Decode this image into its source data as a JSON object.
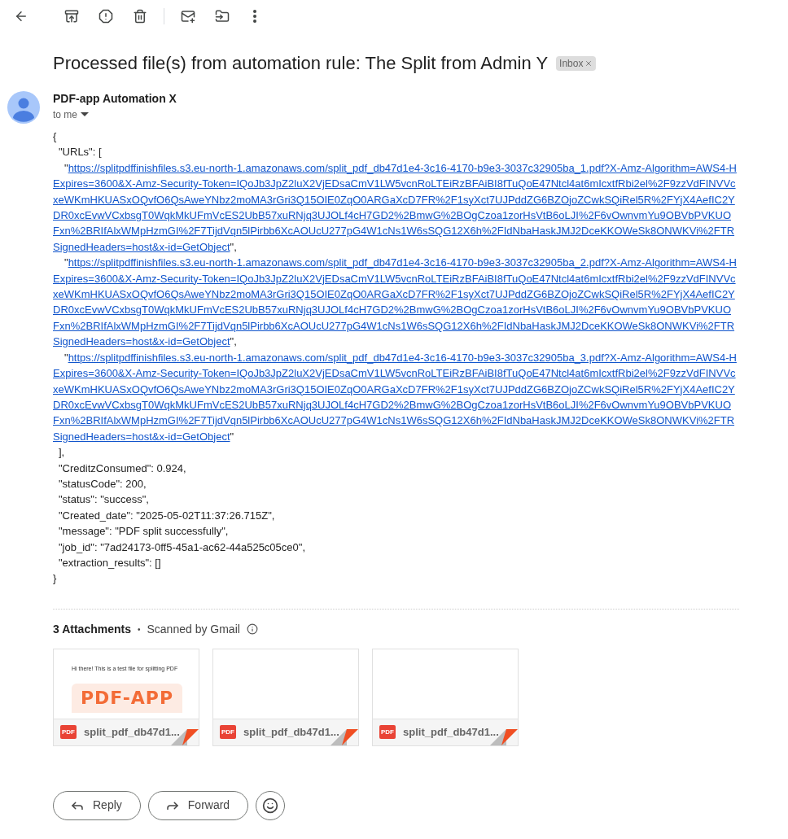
{
  "subject": "Processed file(s) from automation rule: The Split from Admin Y",
  "label": {
    "text": "Inbox",
    "removable": true
  },
  "sender": {
    "name": "PDF-app Automation X",
    "recipient": "to me"
  },
  "body_before": [
    {
      "kind": "brace",
      "text": "{"
    },
    {
      "kind": "member",
      "text": "\"URLs\": ["
    }
  ],
  "urls": [
    {
      "open": "\"",
      "close": "\",",
      "lines": [
        "https://splitpdffinishfiles.s3.eu-north-1.amazonaws.com/split_pdf_db47d1e4-3c16-4170-b9e3-3037c32905ba_1.pdf?X-Amz-Algorithm=AWS4-H",
        "Expires=3600&X-Amz-Security-Token=IQoJb3JpZ2luX2VjEDsaCmV1LW5vcnRoLTEiRzBFAiBI8fTuQoE47Ntcl4at6mIcxtfRbi2el%2F9zzVdFINVVc",
        "xeWKmHKUASxOQvfO6QsAweYNbz2moMA3rGri3Q15OIE0ZqO0ARGaXcD7FR%2F1syXct7UJPddZG6BZOjoZCwkSQiRel5R%2FYjX4AefIC2Y",
        "DR0xcEvwVCxbsgT0WqkMkUFmVcES2UbB57xuRNjq3UJOLf4cH7GD2%2BmwG%2BOgCzoa1zorHsVtB6oLJI%2F6vOwnvmYu9OBVbPVKUO",
        "Fxn%2BRIfAlxWMpHzmGI%2F7TijdVqn5lPirbb6XcAOUcU277pG4W1cNs1W6sSQG12X6h%2FIdNbaHaskJMJ2DceKKOWeSk8ONWKVi%2FTR",
        "SignedHeaders=host&x-id=GetObject"
      ]
    },
    {
      "open": "\"",
      "close": "\",",
      "lines": [
        "https://splitpdffinishfiles.s3.eu-north-1.amazonaws.com/split_pdf_db47d1e4-3c16-4170-b9e3-3037c32905ba_2.pdf?X-Amz-Algorithm=AWS4-H",
        "Expires=3600&X-Amz-Security-Token=IQoJb3JpZ2luX2VjEDsaCmV1LW5vcnRoLTEiRzBFAiBI8fTuQoE47Ntcl4at6mIcxtfRbi2el%2F9zzVdFINVVc",
        "xeWKmHKUASxOQvfO6QsAweYNbz2moMA3rGri3Q15OIE0ZqO0ARGaXcD7FR%2F1syXct7UJPddZG6BZOjoZCwkSQiRel5R%2FYjX4AefIC2Y",
        "DR0xcEvwVCxbsgT0WqkMkUFmVcES2UbB57xuRNjq3UJOLf4cH7GD2%2BmwG%2BOgCzoa1zorHsVtB6oLJI%2F6vOwnvmYu9OBVbPVKUO",
        "Fxn%2BRIfAlxWMpHzmGI%2F7TijdVqn5lPirbb6XcAOUcU277pG4W1cNs1W6sSQG12X6h%2FIdNbaHaskJMJ2DceKKOWeSk8ONWKVi%2FTR",
        "SignedHeaders=host&x-id=GetObject"
      ]
    },
    {
      "open": "\"",
      "close": "\"",
      "lines": [
        "https://splitpdffinishfiles.s3.eu-north-1.amazonaws.com/split_pdf_db47d1e4-3c16-4170-b9e3-3037c32905ba_3.pdf?X-Amz-Algorithm=AWS4-H",
        "Expires=3600&X-Amz-Security-Token=IQoJb3JpZ2luX2VjEDsaCmV1LW5vcnRoLTEiRzBFAiBI8fTuQoE47Ntcl4at6mIcxtfRbi2el%2F9zzVdFINVVc",
        "xeWKmHKUASxOQvfO6QsAweYNbz2moMA3rGri3Q15OIE0ZqO0ARGaXcD7FR%2F1syXct7UJPddZG6BZOjoZCwkSQiRel5R%2FYjX4AefIC2Y",
        "DR0xcEvwVCxbsgT0WqkMkUFmVcES2UbB57xuRNjq3UJOLf4cH7GD2%2BmwG%2BOgCzoa1zorHsVtB6oLJI%2F6vOwnvmYu9OBVbPVKUO",
        "Fxn%2BRIfAlxWMpHzmGI%2F7TijdVqn5lPirbb6XcAOUcU277pG4W1cNs1W6sSQG12X6h%2FIdNbaHaskJMJ2DceKKOWeSk8ONWKVi%2FTR",
        "SignedHeaders=host&x-id=GetObject"
      ]
    }
  ],
  "body_after": [
    {
      "kind": "member",
      "text": "],"
    },
    {
      "kind": "member",
      "text": "\"CreditzConsumed\": 0.924,"
    },
    {
      "kind": "member",
      "text": "\"statusCode\": 200,"
    },
    {
      "kind": "member",
      "text": "\"status\": \"success\","
    },
    {
      "kind": "member",
      "text": "\"Created_date\": \"2025-05-02T11:37:26.715Z\","
    },
    {
      "kind": "member",
      "text": "\"message\": \"PDF split successfully\","
    },
    {
      "kind": "member",
      "text": "\"job_id\": \"7ad24173-0ff5-45a1-ac62-44a525c05ce0\","
    },
    {
      "kind": "member",
      "text": "\"extraction_results\": []"
    },
    {
      "kind": "brace",
      "text": "}"
    }
  ],
  "attachments": {
    "count": "3 Attachments",
    "separator": "•",
    "scan_note": "Scanned by Gmail",
    "files": [
      {
        "name": "split_pdf_db47d1...",
        "badge": "PDF",
        "preview": {
          "kind": "document",
          "line": "Hi there! This is a test file for splitting PDF",
          "logo": "PDF-APP"
        }
      },
      {
        "name": "split_pdf_db47d1...",
        "badge": "PDF",
        "preview": {
          "kind": "blank"
        }
      },
      {
        "name": "split_pdf_db47d1...",
        "badge": "PDF",
        "preview": {
          "kind": "blank"
        }
      }
    ]
  },
  "actions": [
    {
      "kind": "reply",
      "label": "Reply"
    },
    {
      "kind": "forward",
      "label": "Forward"
    },
    {
      "kind": "emoji"
    }
  ]
}
